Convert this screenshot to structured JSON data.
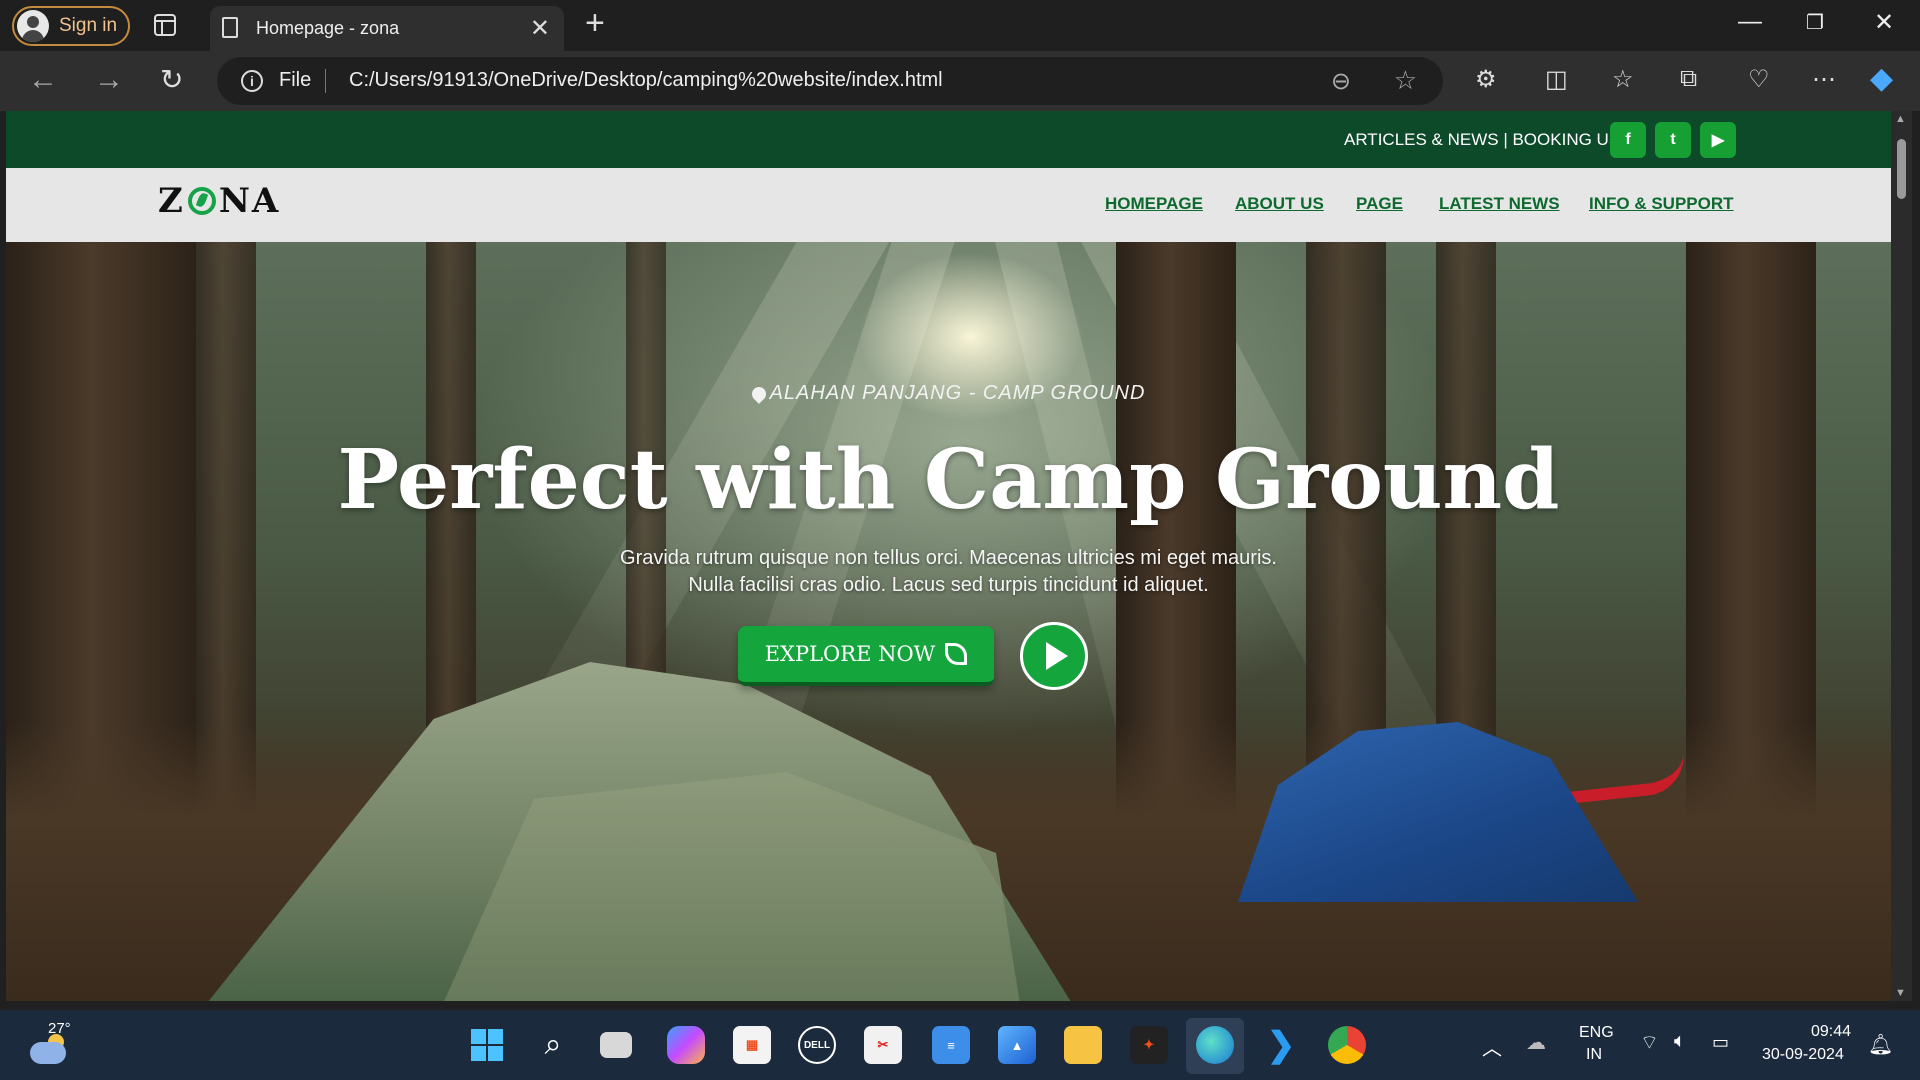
{
  "browser": {
    "signin_label": "Sign in",
    "tab_title": "Homepage - zona",
    "file_label": "File",
    "url": "C:/Users/91913/OneDrive/Desktop/camping%20website/index.html"
  },
  "site": {
    "topbar_links": "ARTICLES & NEWS | BOOKING US",
    "logo": {
      "pre": "Z",
      "post": "NA"
    },
    "nav": [
      "HOMEPAGE",
      "ABOUT US",
      "PAGE",
      "LATEST NEWS",
      "INFO & SUPPORT"
    ],
    "hero": {
      "pretitle": "ALAHAN PANJANG - CAMP GROUND",
      "headline": "Perfect with Camp Ground",
      "desc_line1": "Gravida rutrum quisque non tellus orci. Maecenas ultricies mi eget mauris.",
      "desc_line2": "Nulla facilisi cras odio. Lacus sed turpis tincidunt id aliquet.",
      "cta": "EXPLORE NOW"
    },
    "social_icons": [
      "facebook-icon",
      "twitter-icon",
      "youtube-icon"
    ],
    "colors": {
      "brand_dark": "#0d4a2a",
      "brand_green": "#14a53c",
      "nav_text": "#0d6a2e"
    }
  },
  "taskbar": {
    "temperature": "27°",
    "lang": "ENG",
    "region": "IN",
    "time": "09:44",
    "date": "30-09-2024"
  }
}
